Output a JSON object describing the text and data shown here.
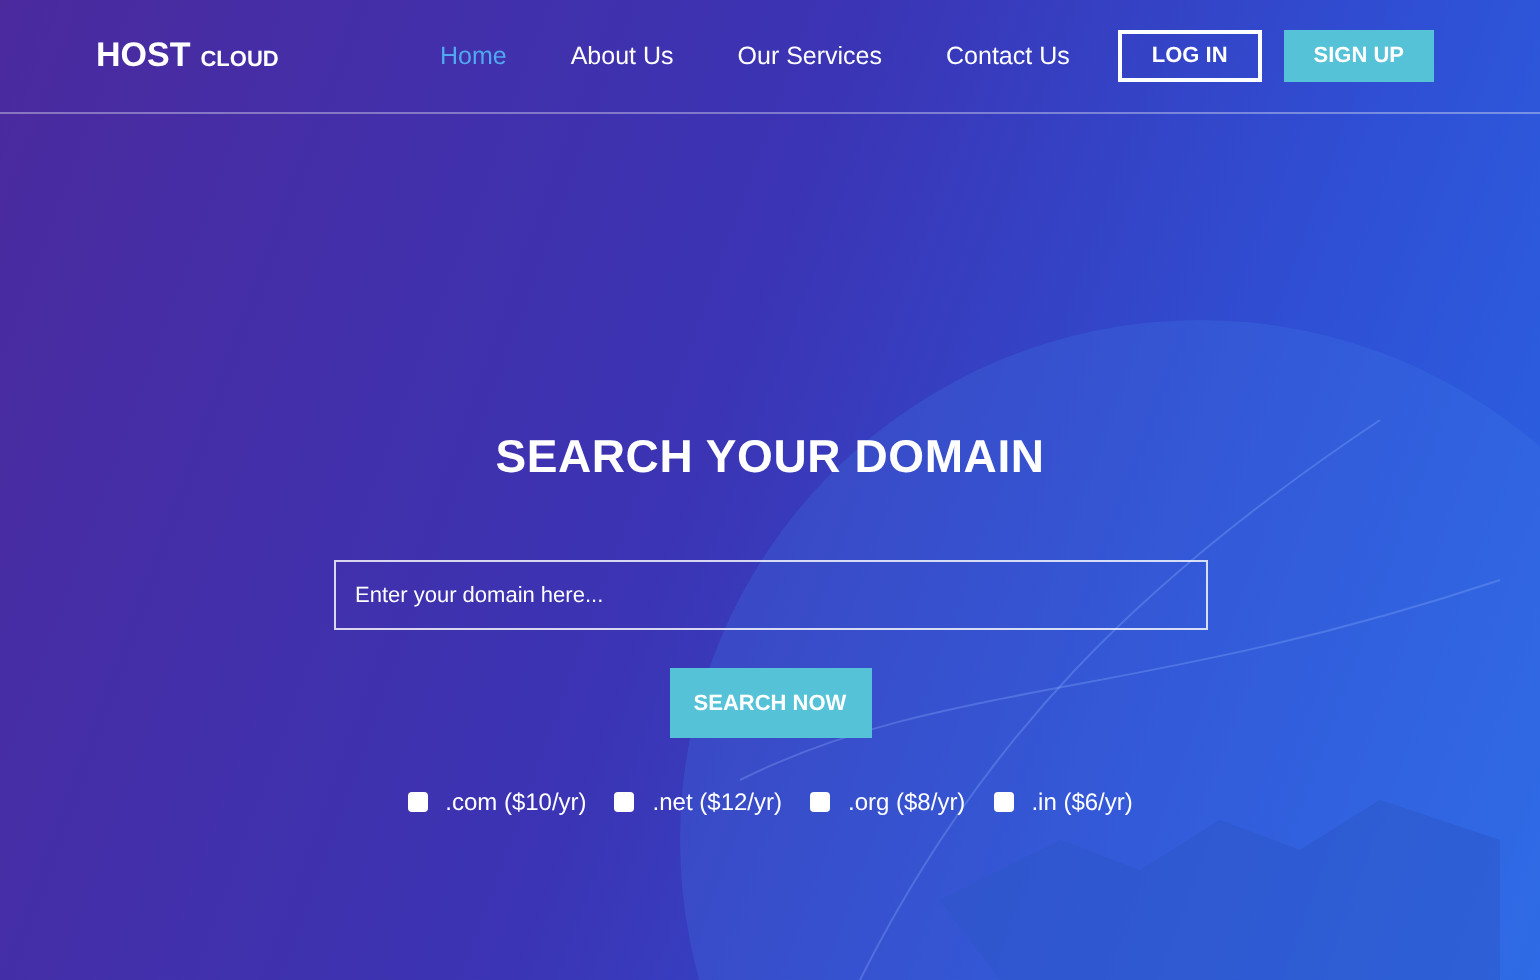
{
  "logo": {
    "name": "HOST",
    "suffix": "CLOUD"
  },
  "nav": [
    {
      "label": "Home",
      "selected": true
    },
    {
      "label": "About Us",
      "selected": false
    },
    {
      "label": "Our Services",
      "selected": false
    },
    {
      "label": "Contact Us",
      "selected": false
    }
  ],
  "auth_buttons": [
    {
      "label": "LOG IN",
      "kind": "outline"
    },
    {
      "label": "SIGN UP",
      "kind": "filled"
    }
  ],
  "hero": {
    "title": "SEARCH YOUR DOMAIN",
    "search": {
      "placeholder": "Enter your domain here..."
    },
    "button": "SEARCH NOW",
    "extensions": [
      {
        "label": ".com ($10/yr)",
        "checked": false
      },
      {
        "label": ".net ($12/yr)",
        "checked": false
      },
      {
        "label": ".org ($8/yr)",
        "checked": false
      },
      {
        "label": ".in ($6/yr)",
        "checked": false
      }
    ]
  }
}
